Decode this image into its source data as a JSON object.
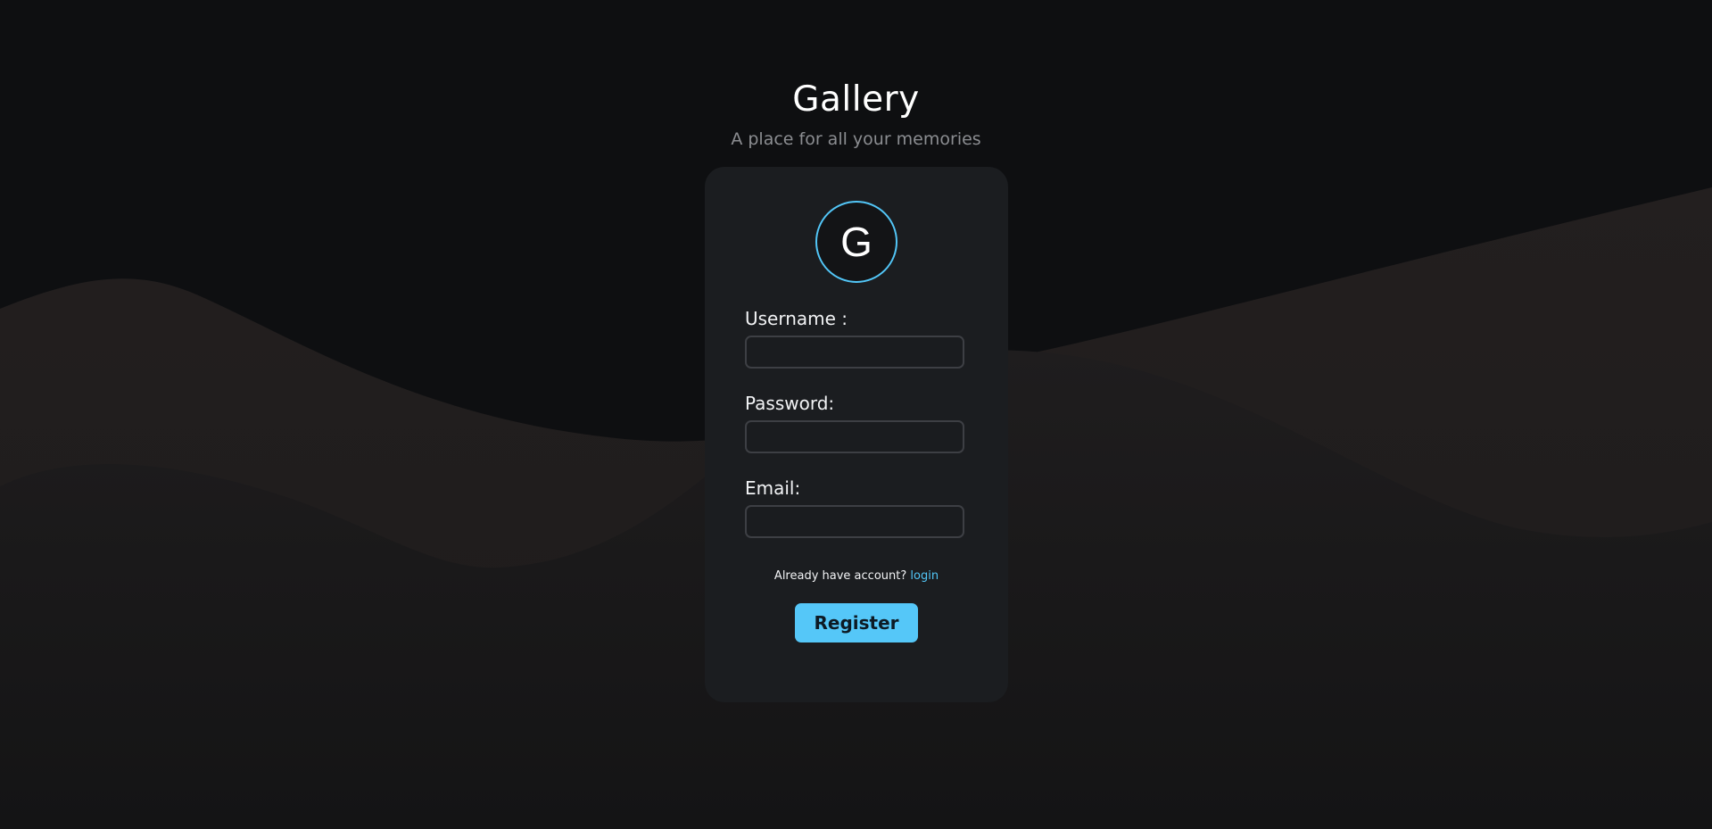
{
  "header": {
    "title": "Gallery",
    "subtitle": "A place for all your memories"
  },
  "avatar": {
    "letter": "G",
    "border_color": "#52c6f7"
  },
  "form": {
    "username_label": "Username :",
    "username_value": "",
    "password_label": "Password:",
    "password_value": "",
    "email_label": "Email:",
    "email_value": ""
  },
  "login_prompt": {
    "text": "Already have account? ",
    "link_label": "login"
  },
  "register_button": {
    "label": "Register"
  },
  "colors": {
    "background": "#0e0f11",
    "card": "#1b1d20",
    "accent": "#55c7f8"
  }
}
